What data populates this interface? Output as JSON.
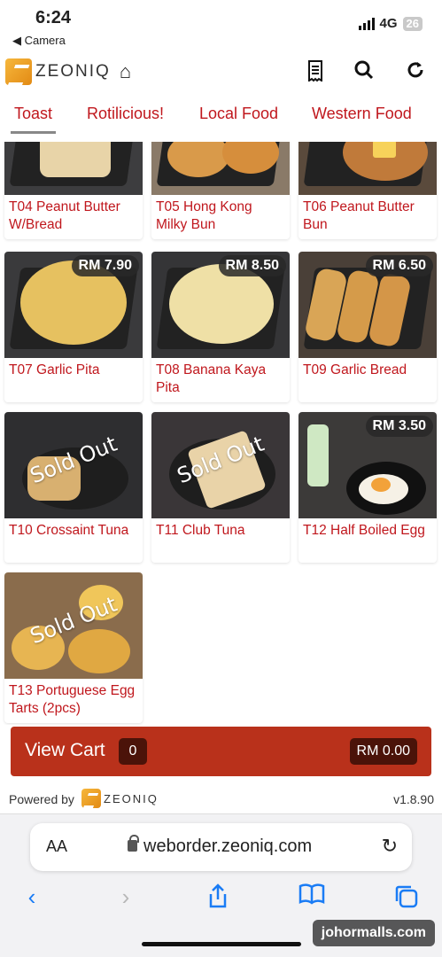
{
  "status": {
    "time": "6:24",
    "back_label": "◀ Camera",
    "network": "4G",
    "battery": "26"
  },
  "header": {
    "logo_text": "ZEONIQ"
  },
  "tabs": [
    {
      "label": "Toast"
    },
    {
      "label": "Rotilicious!"
    },
    {
      "label": "Local Food"
    },
    {
      "label": "Western Food"
    }
  ],
  "items": [
    {
      "name": "T04 Peanut Butter W/Bread",
      "price": "",
      "sold_out": false
    },
    {
      "name": "T05 Hong Kong Milky Bun",
      "price": "",
      "sold_out": false
    },
    {
      "name": "T06 Peanut Butter Bun",
      "price": "",
      "sold_out": false
    },
    {
      "name": "T07 Garlic Pita",
      "price": "RM 7.90",
      "sold_out": false
    },
    {
      "name": "T08 Banana Kaya Pita",
      "price": "RM 8.50",
      "sold_out": false
    },
    {
      "name": "T09 Garlic Bread",
      "price": "RM 6.50",
      "sold_out": false
    },
    {
      "name": "T10 Crossaint Tuna",
      "price": "",
      "sold_out": true
    },
    {
      "name": "T11 Club Tuna",
      "price": "",
      "sold_out": true
    },
    {
      "name": "T12 Half Boiled Egg",
      "price": "RM 3.50",
      "sold_out": false
    },
    {
      "name": "T13 Portuguese Egg Tarts (2pcs)",
      "price": "",
      "sold_out": true
    }
  ],
  "sold_out_label": "Sold Out",
  "cart": {
    "label": "View Cart",
    "count": "0",
    "total": "RM 0.00"
  },
  "footer": {
    "powered_by": "Powered by",
    "logo_text": "ZEONIQ",
    "version": "v1.8.90"
  },
  "browser": {
    "aa": "AA",
    "url": "weborder.zeoniq.com"
  },
  "watermark": "johormalls.com",
  "colors": {
    "accent": "#c0171d",
    "cart_bg": "#b9311b",
    "nav_blue": "#1a7cf5"
  }
}
